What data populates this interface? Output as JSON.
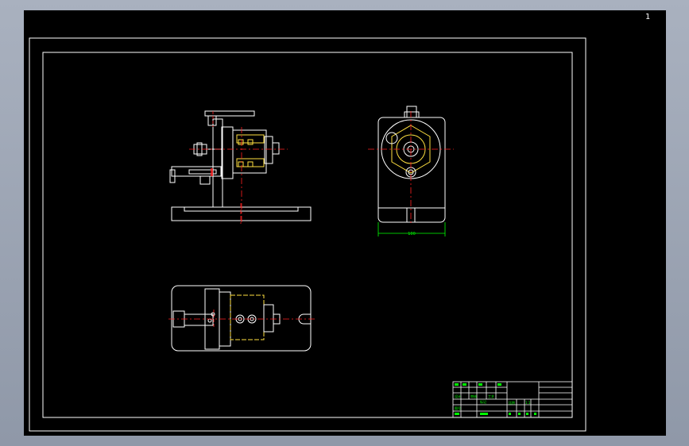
{
  "viewport": {
    "background": "#000000",
    "corner_label": "1"
  },
  "drawing": {
    "dimension_text": "100",
    "colors": {
      "outline": "#ffffff",
      "center_line": "#ff2020",
      "part_yellow": "#ffe040",
      "dimension": "#00ff00"
    }
  },
  "title_block": {
    "cells": [
      "设计",
      "审核",
      "工艺",
      "比例",
      "1:1",
      "图号",
      "标记"
    ]
  }
}
